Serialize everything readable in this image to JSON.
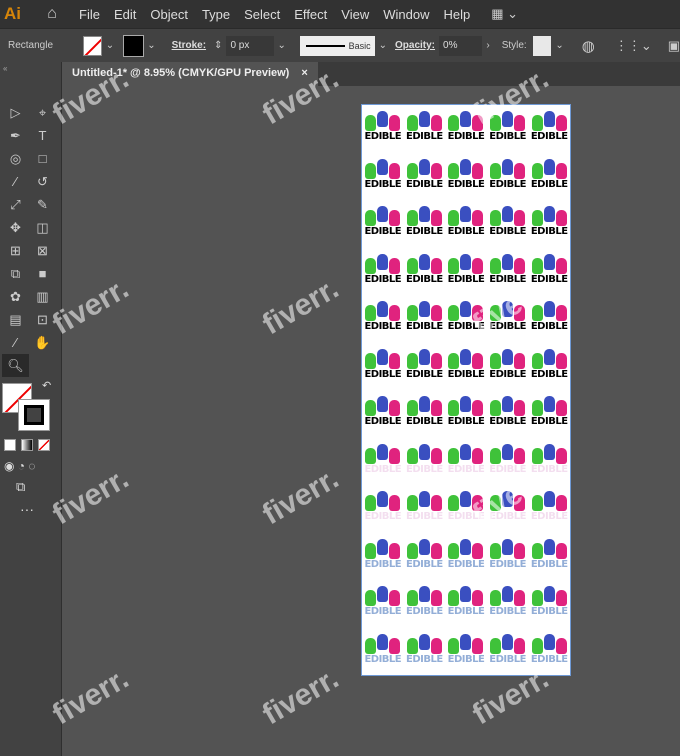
{
  "app": {
    "logo": "Ai"
  },
  "menu": [
    "File",
    "Edit",
    "Object",
    "Type",
    "Select",
    "Effect",
    "View",
    "Window",
    "Help"
  ],
  "control": {
    "tool_name": "Rectangle",
    "stroke_label": "Stroke:",
    "stroke_value": "0 px",
    "brush": "Basic",
    "opacity_label": "Opacity:",
    "opacity_value": "0%",
    "style_label": "Style:"
  },
  "tab": {
    "title": "Untitled-1* @ 8.95% (CMYK/GPU Preview)",
    "close": "×"
  },
  "artwork": {
    "text": "EDIBLE",
    "rows": 12,
    "cols": 5,
    "colors": {
      "green": "#3fc23a",
      "blue": "#3a4fc0",
      "pink": "#e0237e"
    }
  },
  "watermark": "fiverr."
}
